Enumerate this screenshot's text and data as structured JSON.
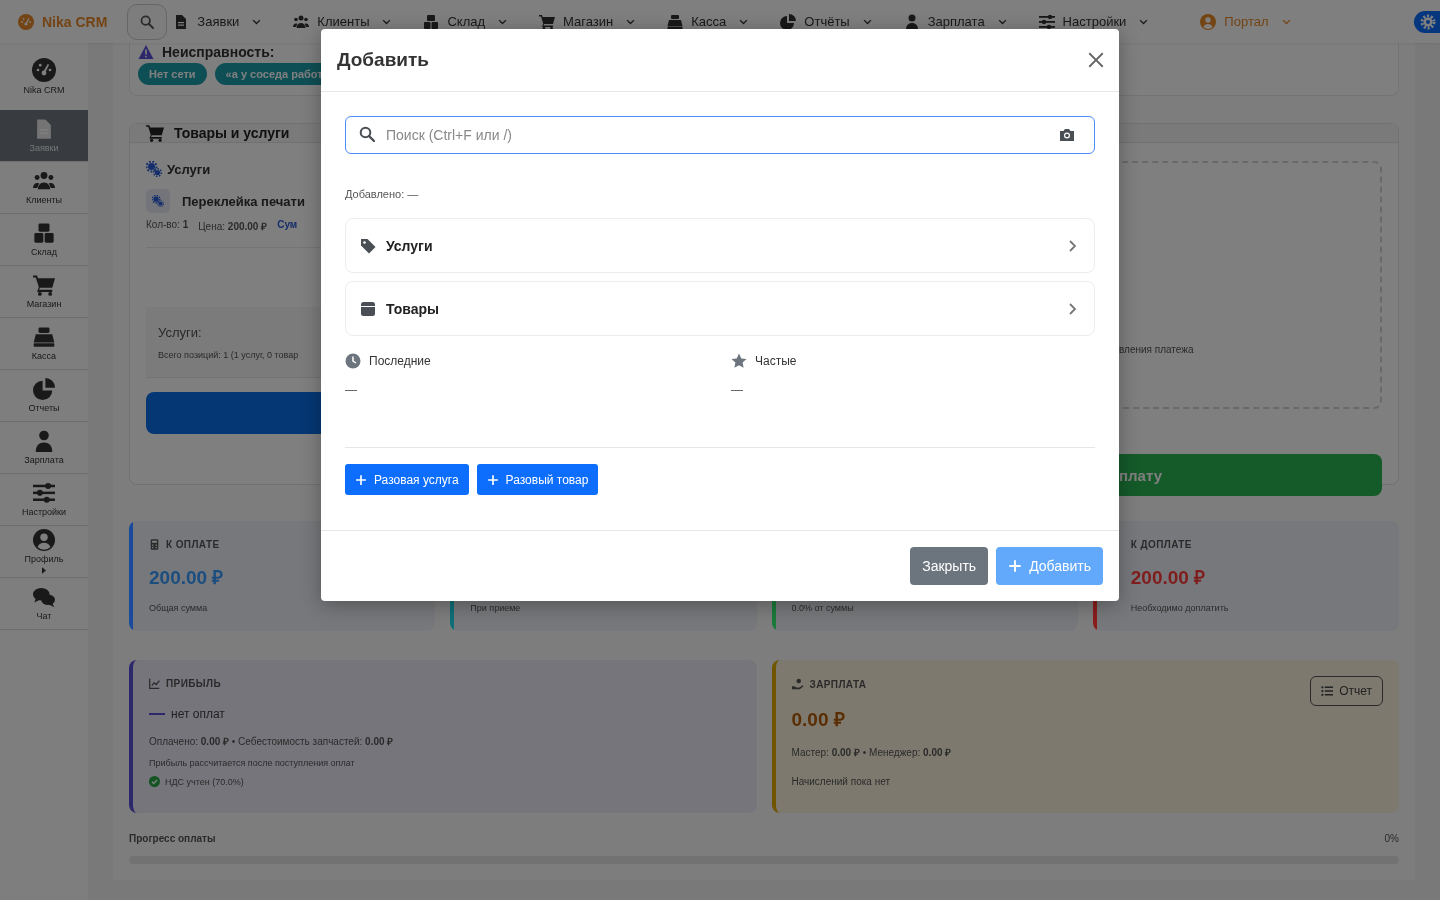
{
  "nav": {
    "brand": "Nika CRM",
    "items": [
      "Заявки",
      "Клиенты",
      "Склад",
      "Магазин",
      "Касса",
      "Отчёты",
      "Зарплата",
      "Настройки"
    ],
    "portal": "Портал"
  },
  "sidebar": {
    "items": [
      {
        "label": "Nika CRM",
        "selected": false,
        "submenu": false
      },
      {
        "label": "Заявки",
        "selected": true,
        "submenu": false
      },
      {
        "label": "Клиенты",
        "selected": false,
        "submenu": false
      },
      {
        "label": "Склад",
        "selected": false,
        "submenu": false
      },
      {
        "label": "Магазин",
        "selected": false,
        "submenu": false
      },
      {
        "label": "Касса",
        "selected": false,
        "submenu": false
      },
      {
        "label": "Отчеты",
        "selected": false,
        "submenu": false
      },
      {
        "label": "Зарплата",
        "selected": false,
        "submenu": false
      },
      {
        "label": "Настройки",
        "selected": false,
        "submenu": false
      },
      {
        "label": "Профиль",
        "selected": false,
        "submenu": true
      },
      {
        "label": "Чат",
        "selected": false,
        "submenu": false
      }
    ]
  },
  "issue": {
    "title": "Неисправность:",
    "tags": [
      "Нет сети",
      "«а у соседа работ"
    ]
  },
  "goods": {
    "title": "Товары и услуги",
    "section": "Услуги",
    "item": {
      "name": "Переклейка печати",
      "qty": "Кол-во: **1**",
      "price": "Цена: **200.00 ₽**",
      "sum": "Сум"
    },
    "summary": {
      "title": "Услуги:",
      "text": "Всего позиций: 1 (1 услуг, 0 товар"
    },
    "payment_note": "вления платежа",
    "pay_button": "плату"
  },
  "stats": [
    {
      "kind": "full",
      "label": "К ОПЛАТЕ",
      "value": "200.00 ₽",
      "note": "Общая сумма",
      "color": "#1a4a9e"
    },
    {
      "kind": "partial",
      "note": "При приеме",
      "color": "#0e6f78"
    },
    {
      "kind": "partial",
      "note": "0.0% от суммы",
      "color": "#1a7a3a"
    },
    {
      "kind": "full",
      "label": "К ДОПЛАТЕ",
      "value": "200.00 ₽",
      "note": "Необходимо доплатить",
      "color": "#8b1c1c"
    }
  ],
  "profit": {
    "label": "ПРИБЫЛЬ",
    "status": "нет оплат",
    "paid": "Оплачено: **0.00 ₽** • Себестоимость запчастей: **0.00 ₽**",
    "hint": "Прибыль рассчитается после поступления оплат",
    "vat": "НДС учтен (70.0%)"
  },
  "salary": {
    "label": "ЗАРПЛАТА",
    "value": "0.00 ₽",
    "split": "Мастер: **0.00 ₽** • Менеджер: **0.00 ₽**",
    "note": "Начислений пока нет",
    "button": "Отчет"
  },
  "progress": {
    "label": "Прогресс оплаты",
    "reading": "0%",
    "level": 0
  },
  "modal": {
    "title": "Добавить",
    "search": {
      "placeholder": "Поиск (Ctrl+F или /)"
    },
    "added": "Добавлено: —",
    "categories": [
      "Услуги",
      "Товары"
    ],
    "lists": [
      {
        "title": "Последние",
        "empty": "—"
      },
      {
        "title": "Частые",
        "empty": "—"
      }
    ],
    "quick_buttons": [
      "Разовая услуга",
      "Разовый товар"
    ],
    "footer": {
      "close": "Закрыть",
      "submit": "Добавить",
      "submit_disabled": true
    }
  }
}
